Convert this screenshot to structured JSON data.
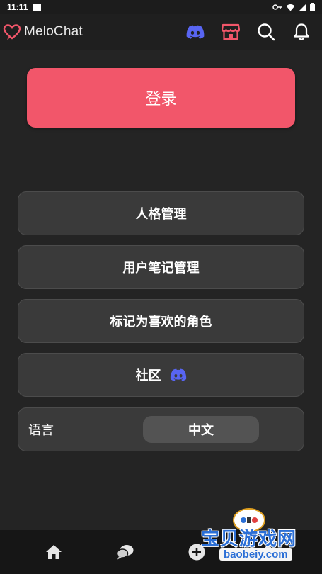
{
  "status_bar": {
    "time": "11:11"
  },
  "app_bar": {
    "title": "MeloChat",
    "icons": [
      "discord-icon",
      "store-icon",
      "search-icon",
      "bell-icon"
    ],
    "colors": {
      "discord": "#5865f2",
      "store": "#f2566a"
    }
  },
  "main": {
    "login_label": "登录",
    "menu": [
      {
        "label": "人格管理"
      },
      {
        "label": "用户笔记管理"
      },
      {
        "label": "标记为喜欢的角色"
      },
      {
        "label": "社区"
      }
    ],
    "language": {
      "label": "语言",
      "value": "中文"
    }
  },
  "bottom_nav": {
    "icons": [
      "home-icon",
      "chat-icon",
      "add-icon",
      "profile-icon"
    ]
  },
  "watermark": {
    "text": "宝贝游戏网",
    "url": "baobeiy.com"
  },
  "colors": {
    "accent": "#f2566a",
    "background": "#242424",
    "card": "#3a3a3a"
  }
}
